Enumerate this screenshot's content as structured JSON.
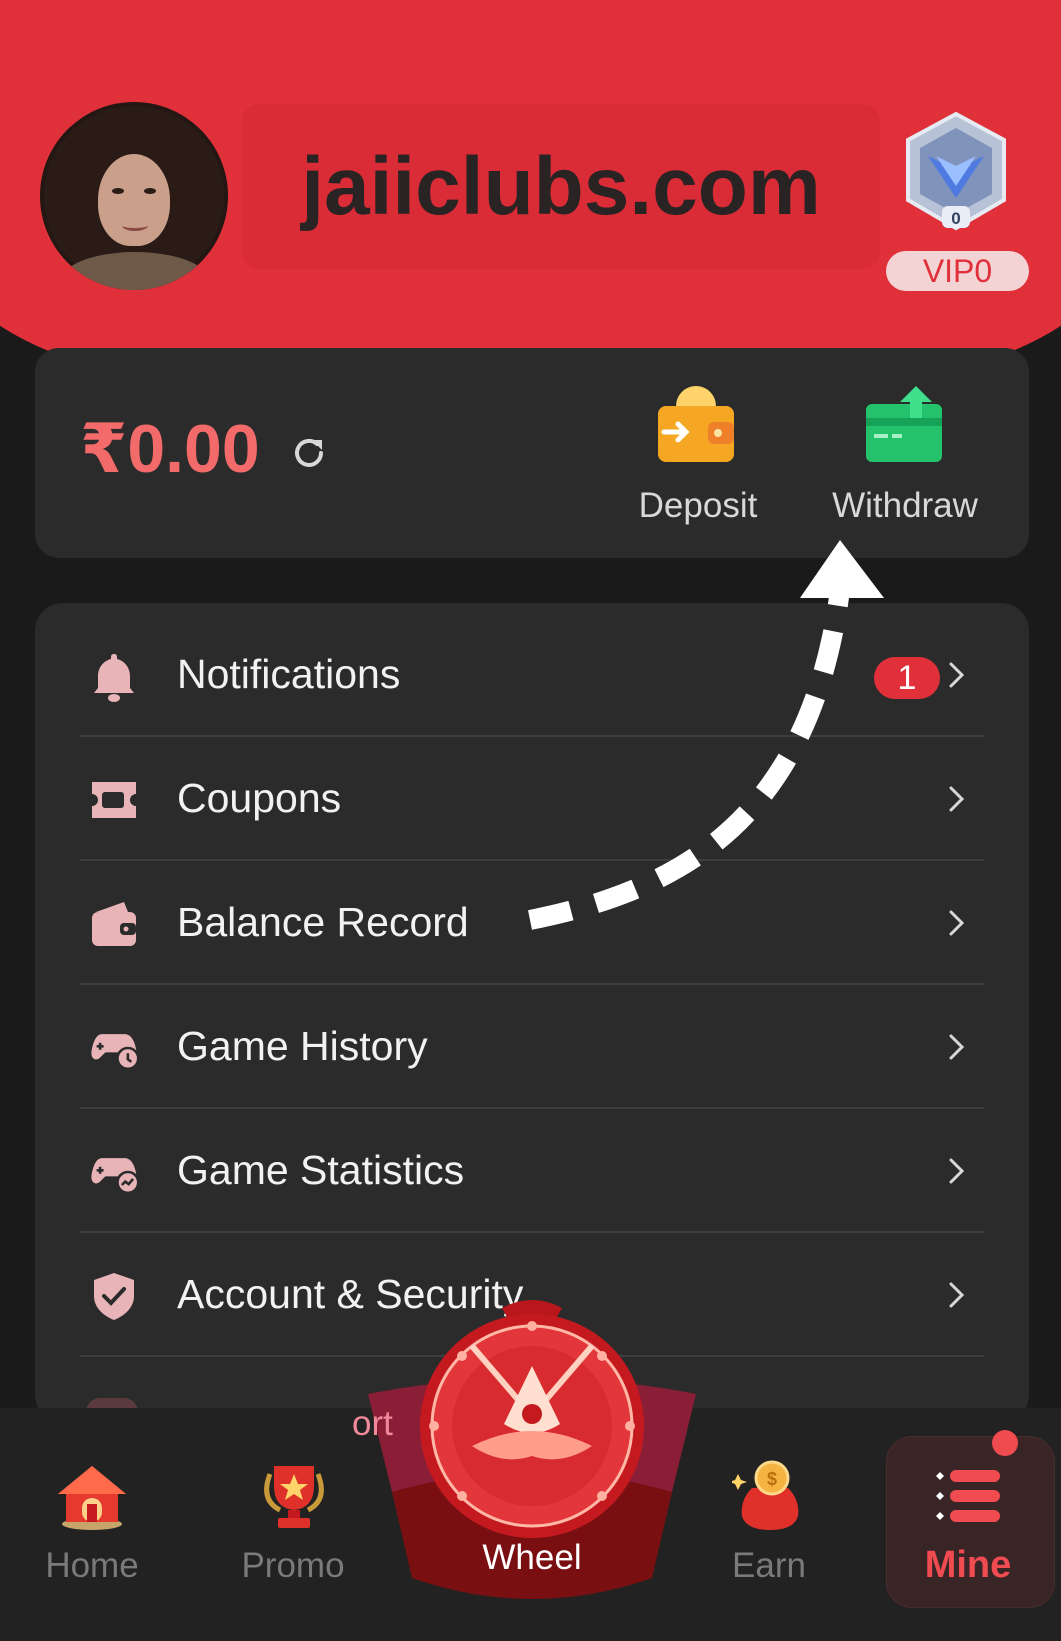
{
  "header": {
    "site_name": "jaiiclubs.com",
    "vip_level_label": "VIP0",
    "vip_badge_number": "0"
  },
  "balance": {
    "amount": "₹0.00",
    "deposit_label": "Deposit",
    "withdraw_label": "Withdraw"
  },
  "menu": {
    "items": [
      {
        "label": "Notifications",
        "icon": "bell-icon",
        "badge": "1"
      },
      {
        "label": "Coupons",
        "icon": "coupon-icon"
      },
      {
        "label": "Balance Record",
        "icon": "wallet-icon"
      },
      {
        "label": "Game History",
        "icon": "gamepad-clock-icon"
      },
      {
        "label": "Game Statistics",
        "icon": "gamepad-chart-icon"
      },
      {
        "label": "Account & Security",
        "icon": "shield-check-icon"
      }
    ],
    "partial_item_fragment": "ort"
  },
  "bottom_nav": {
    "items": [
      {
        "label": "Home",
        "icon": "home-icon"
      },
      {
        "label": "Promo",
        "icon": "trophy-icon"
      },
      {
        "label": "Wheel",
        "icon": "wheel-icon"
      },
      {
        "label": "Earn",
        "icon": "money-bag-icon"
      },
      {
        "label": "Mine",
        "icon": "menu-list-icon",
        "active": true
      }
    ]
  },
  "colors": {
    "brand_red": "#e0303a",
    "balance_red": "#f26a6a",
    "card_bg": "#2b2b2b",
    "page_bg": "#1a1a1a",
    "icon_pink": "#e8b4b8"
  }
}
